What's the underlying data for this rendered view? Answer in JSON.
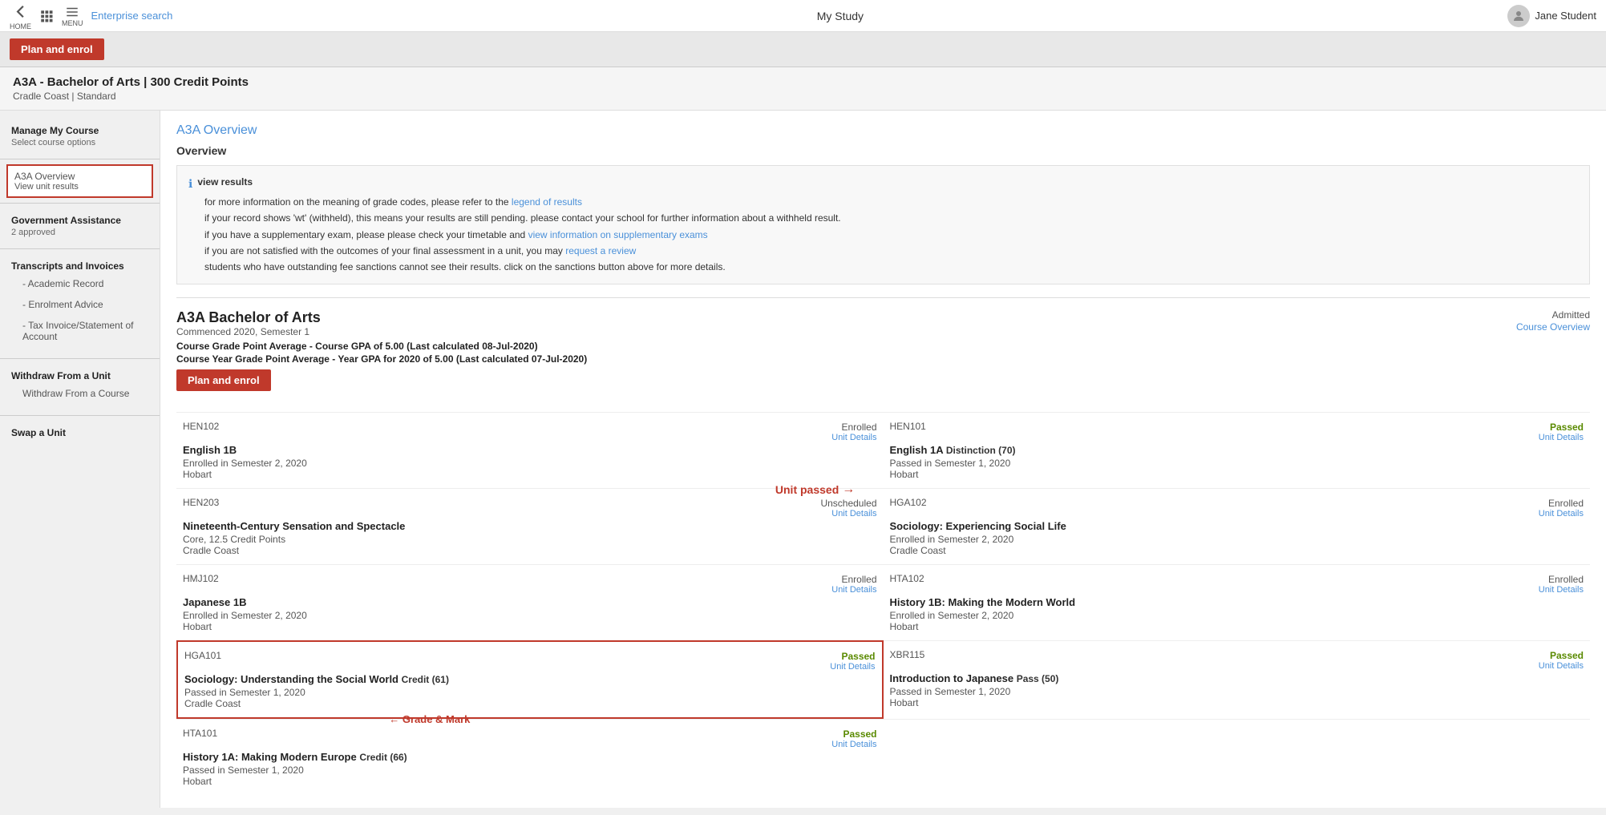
{
  "topNav": {
    "title": "My Study",
    "homeLabel": "HOME",
    "menuLabel": "MENU",
    "enterpriseSearch": "Enterprise search",
    "userName": "Jane Student"
  },
  "planEnrolBtn": "Plan and enrol",
  "courseHeader": {
    "title": "A3A - Bachelor of Arts | 300 Credit Points",
    "sub": "Cradle Coast | Standard"
  },
  "sidebar": {
    "manageMyCourse": "Manage My Course",
    "selectCourseOptions": "Select course options",
    "activeItem": {
      "title": "A3A Overview",
      "sub": "View unit results"
    },
    "govAssistance": "Government Assistance",
    "govApproved": "2 approved",
    "transcripts": "Transcripts and Invoices",
    "transcriptLinks": [
      "- Academic Record",
      "- Enrolment Advice",
      "- Tax Invoice/Statement of Account"
    ],
    "withdrawUnit": "Withdraw From a Unit",
    "withdrawCourse": "Withdraw From a Course",
    "swapUnit": "Swap a Unit"
  },
  "mainContent": {
    "sectionTitle": "A3A Overview",
    "overviewLabel": "Overview",
    "infoBox": {
      "viewResults": "view results",
      "infoLine1": "for more information on the meaning of grade codes, please refer to the",
      "legendLink": "legend of results",
      "infoLine2": "if your record shows 'wt' (withheld), this means your results are still pending. please contact your school for further information about a withheld result.",
      "infoLine3_pre": "if you have a supplementary exam, please please check your timetable and",
      "infoLine3_link": "view information on supplementary exams",
      "infoLine4_pre": "if you are not satisfied with the outcomes of your final assessment in a unit, you may",
      "infoLine4_link": "request a review",
      "infoLine5": "students who have outstanding fee sanctions cannot see their results. click on the sanctions button above for more details."
    },
    "courseBlock": {
      "title": "A3A Bachelor of Arts",
      "commenced": "Commenced 2020, Semester 1",
      "gpa1": "Course Grade Point Average - Course GPA of 5.00 (Last calculated 08-Jul-2020)",
      "gpa2": "Course Year Grade Point Average - Year GPA for 2020 of 5.00 (Last calculated 07-Jul-2020)",
      "status": "Admitted",
      "courseOverviewLink": "Course Overview"
    },
    "units": [
      {
        "col": "left",
        "code": "HEN102",
        "name": "English 1B",
        "info1": "Enrolled in Semester 2, 2020",
        "info2": "Hobart",
        "status": "Enrolled",
        "statusClass": "enrolled",
        "detailsLink": "Unit Details"
      },
      {
        "col": "right",
        "code": "HEN101",
        "name": "English 1A",
        "credit": "Distinction (70)",
        "info1": "Passed in Semester 1, 2020",
        "info2": "Hobart",
        "status": "Passed",
        "statusClass": "passed",
        "detailsLink": "Unit Details"
      },
      {
        "col": "left",
        "code": "HEN203",
        "name": "Nineteenth-Century Sensation and Spectacle",
        "info1": "Core, 12.5 Credit Points",
        "info2": "Cradle Coast",
        "status": "Unscheduled",
        "statusClass": "unscheduled",
        "detailsLink": "Unit Details"
      },
      {
        "col": "right",
        "code": "HGA102",
        "name": "Sociology: Experiencing Social Life",
        "info1": "Enrolled in Semester 2, 2020",
        "info2": "Cradle Coast",
        "status": "Enrolled",
        "statusClass": "enrolled",
        "detailsLink": "Unit Details"
      },
      {
        "col": "left",
        "code": "HMJ102",
        "name": "Japanese 1B",
        "info1": "Enrolled in Semester 2, 2020",
        "info2": "Hobart",
        "status": "Enrolled",
        "statusClass": "enrolled",
        "detailsLink": "Unit Details"
      },
      {
        "col": "right",
        "code": "HTA102",
        "name": "History 1B: Making the Modern World",
        "info1": "Enrolled in Semester 2, 2020",
        "info2": "Hobart",
        "status": "Enrolled",
        "statusClass": "enrolled",
        "detailsLink": "Unit Details"
      },
      {
        "col": "left",
        "code": "HGA101",
        "name": "Sociology: Understanding the Social World",
        "credit": "Credit (61)",
        "info1": "Passed in Semester 1, 2020",
        "info2": "Cradle Coast",
        "status": "Passed",
        "statusClass": "passed",
        "detailsLink": "Unit Details",
        "highlight": true
      },
      {
        "col": "right",
        "code": "XBR115",
        "name": "Introduction to Japanese",
        "credit": "Pass (50)",
        "info1": "Passed in Semester 1, 2020",
        "info2": "Hobart",
        "status": "Passed",
        "statusClass": "passed",
        "detailsLink": "Unit Details"
      },
      {
        "col": "left",
        "code": "HTA101",
        "name": "History 1A: Making Modern Europe",
        "credit": "Credit (66)",
        "info1": "Passed in Semester 1, 2020",
        "info2": "Hobart",
        "status": "Passed",
        "statusClass": "passed",
        "detailsLink": "Unit Details"
      }
    ],
    "annotations": {
      "unitPassed": "Unit passed",
      "gradeAndMark": "Grade & Mark"
    }
  }
}
